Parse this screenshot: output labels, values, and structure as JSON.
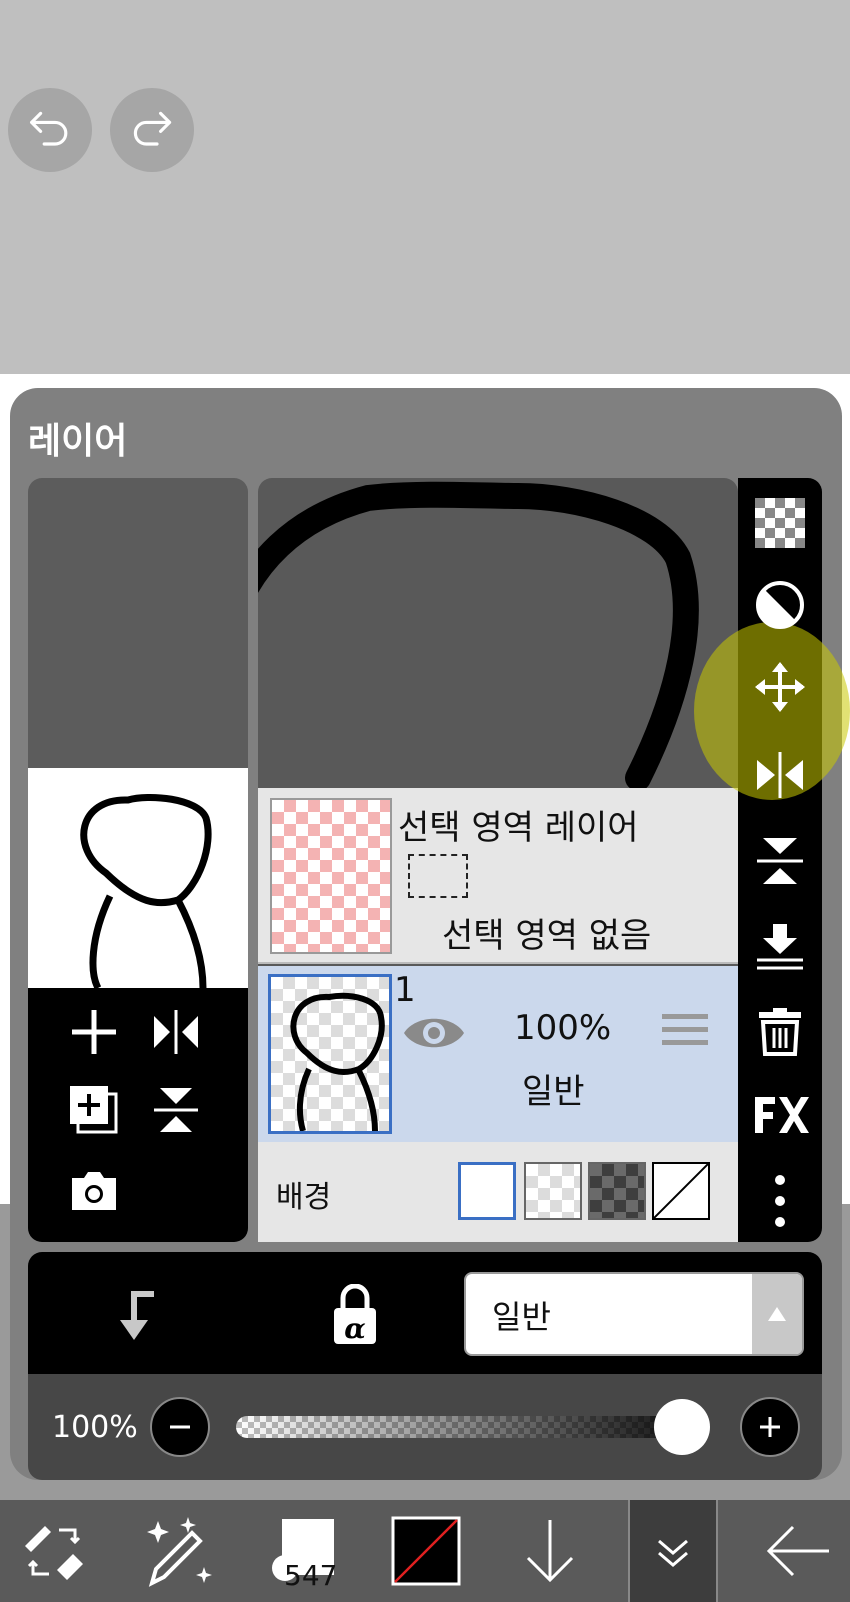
{
  "panel": {
    "title": "레이어"
  },
  "layers": {
    "selection": {
      "name": "선택 영역 레이어",
      "status": "선택 영역 없음"
    },
    "layer1": {
      "number": "1",
      "opacity": "100%",
      "blend": "일반"
    },
    "background": {
      "label": "배경"
    }
  },
  "blend_mode": {
    "selected": "일반"
  },
  "opacity": {
    "label": "100%",
    "value": 1.0
  },
  "toolbar": {
    "brush_size": "547"
  },
  "icons": {
    "undo": "undo-icon",
    "redo": "redo-icon",
    "strip": [
      "transparency-icon",
      "contrast-icon",
      "move-icon",
      "flip-horizontal-icon",
      "flip-vertical-icon",
      "merge-down-icon",
      "trash-icon",
      "fx-icon",
      "more-icon"
    ],
    "left_tools": [
      "add-layer-icon",
      "flip-h-icon",
      "copy-layer-icon",
      "flip-v-icon",
      "camera-icon"
    ]
  },
  "colors": {
    "highlight": "#c8c800",
    "selected_layer_bg": "#cbd8ec",
    "accent_border": "#3a6fc4"
  }
}
